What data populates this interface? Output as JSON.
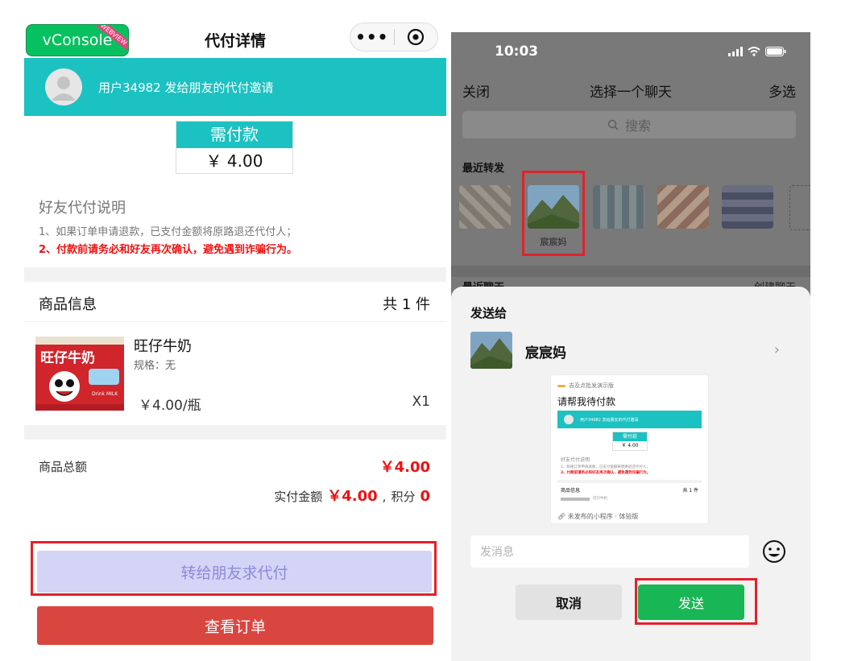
{
  "left": {
    "vconsole": {
      "label": "vConsole",
      "ribbon": "WEBVIEW"
    },
    "nav_title": "代付详情",
    "capsule": {
      "more": "•••"
    },
    "invite_text": "用户34982  发给朋友的代付邀请",
    "pay": {
      "header": "需付款",
      "amount": "￥ 4.00"
    },
    "notes": {
      "title": "好友代付说明",
      "line1": "1、如果订单申请退款，已支付金额将原路退还代付人；",
      "line2": "2、付款前请务必和好友再次确认，避免遇到诈骗行为。"
    },
    "goods": {
      "header": "商品信息",
      "count": "共 1 件"
    },
    "product": {
      "name": "旺仔牛奶",
      "spec": "规格：无",
      "price": "￥4.00/瓶",
      "qty": "X1",
      "img_text": "旺仔牛奶",
      "img_badge": "Drink MILK"
    },
    "totals": {
      "goods_total_label": "商品总额",
      "goods_total_value": "￥4.00",
      "paid_label": "实付金额",
      "paid_value": "￥4.00",
      "points_label": "积分",
      "points_value": "0"
    },
    "buttons": {
      "forward": "转给朋友求代付",
      "view_order": "查看订单"
    }
  },
  "right": {
    "status": {
      "time": "10:03"
    },
    "nav": {
      "close": "关闭",
      "title": "选择一个聊天",
      "multi": "多选"
    },
    "search": {
      "placeholder": "搜索"
    },
    "recent_forward_label": "最近转发",
    "contacts": [
      {
        "name": ""
      },
      {
        "name": "宸宸妈"
      },
      {
        "name": ""
      },
      {
        "name": ""
      },
      {
        "name": ""
      }
    ],
    "recent_chats_label": "最近聊天",
    "create_chat": "创建聊天",
    "sheet": {
      "send_to": "发送给",
      "target_name": "宸宸妈",
      "card": {
        "app_name": "吉及点批发演示版",
        "title": "请帮我待付款",
        "mini_invite": "用户34982  发给朋友的代付邀请",
        "mini_pay_header": "需付款",
        "mini_pay_amount": "￥ 4.00",
        "mini_note_title": "好友代付说明",
        "mini_note1": "1、如果订单申请退款，已支付金额将原路退还代付人；",
        "mini_note2": "2、付款前请务必和好友再次确认，避免遇到诈骗行为。",
        "mini_goods": "商品信息",
        "mini_count": "共 1 件",
        "mini_item": "旺仔牛奶",
        "footer": "未发布的小程序 · 体验版"
      },
      "message_placeholder": "发消息",
      "cancel": "取消",
      "send": "发送"
    }
  },
  "colors": {
    "teal": "#1cc1c1",
    "red_text": "#e11111",
    "highlight_red": "#e1212b",
    "wechat_green": "#18b655",
    "forward_button_bg": "#d4d4f6",
    "order_button_bg": "#d9463f"
  }
}
